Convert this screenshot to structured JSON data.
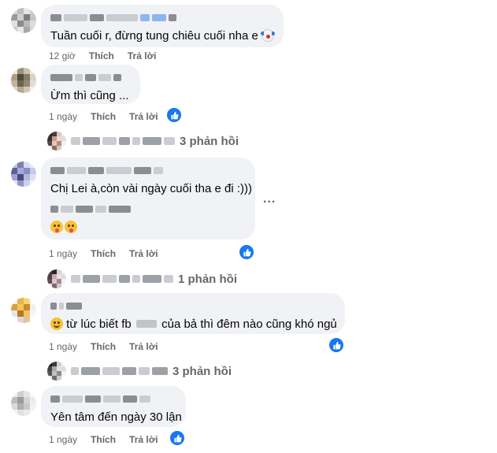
{
  "colors": {
    "bubble": "#f0f2f5",
    "meta": "#65676b",
    "like": "#1877f2",
    "text": "#050505"
  },
  "comments": [
    {
      "text": "Tuần cuối r, đừng tung chiêu cuối nha e",
      "emoji": "clown-face",
      "time": "12 giờ",
      "like": "Thích",
      "reply": "Trả lời",
      "has_reaction": false
    },
    {
      "text": "Ừm thì cũng ...",
      "time": "1 ngày",
      "like": "Thích",
      "reply": "Trả lời",
      "has_reaction": true,
      "replies": "3 phản hồi"
    },
    {
      "text": "Chị Lei à,còn vài ngày cuối tha e đi :)))",
      "emoji": "laughing-tongue-faces",
      "time": "1 ngày",
      "like": "Thích",
      "reply": "Trả lời",
      "has_reaction": true,
      "replies": "1 phản hồi"
    },
    {
      "text": "từ lúc biết fb",
      "text_after": "của bả thì đêm nào cũng khó ngủ",
      "emoji": "smiling-face",
      "time": "1 ngày",
      "like": "Thích",
      "reply": "Trả lời",
      "has_reaction": true,
      "replies": "3 phản hồi"
    },
    {
      "text": "Yên tâm đến ngày 30 lận",
      "time": "1 ngày",
      "like": "Thích",
      "reply": "Trả lời",
      "has_reaction": true
    }
  ],
  "more_options": "..."
}
